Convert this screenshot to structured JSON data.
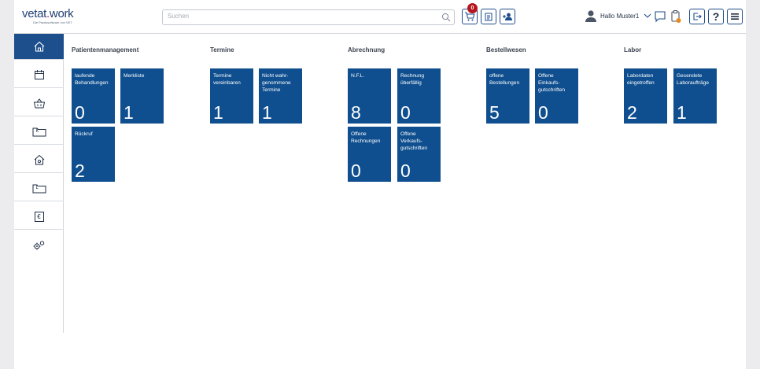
{
  "header": {
    "logo_main": "vetat",
    "logo_dot": ".",
    "logo_end": "work",
    "logo_sub": "Die Praxissoftware von VET",
    "search_placeholder": "Suchen",
    "cart_badge": "0",
    "user_label": "Hallo Muster1",
    "help_label": "?"
  },
  "sidebar": {
    "items": [
      {
        "icon": "home-icon",
        "active": true
      },
      {
        "icon": "calendar-icon"
      },
      {
        "icon": "basket-icon"
      },
      {
        "icon": "folder-k-icon",
        "letter": "K"
      },
      {
        "icon": "house-settings-icon"
      },
      {
        "icon": "folder-l-icon",
        "letter": "L"
      },
      {
        "icon": "euro-icon",
        "letter": "€"
      },
      {
        "icon": "gears-icon"
      }
    ]
  },
  "sections": {
    "patient": "Patientenmanagement",
    "termine": "Termine",
    "abrechnung": "Abrechnung",
    "bestellwesen": "Bestellwesen",
    "labor": "Labor"
  },
  "tiles": {
    "laufende": {
      "label": "laufende Behandlungen",
      "value": "0"
    },
    "merkliste": {
      "label": "Merkliste",
      "value": "1"
    },
    "rueckruf": {
      "label": "Rückruf",
      "value": "2"
    },
    "termine_vereinbaren": {
      "label": "Termine vereinbaren",
      "value": "1"
    },
    "nicht_wahrgenommen": {
      "label": "Nicht wahr-genommene Termine",
      "value": "1"
    },
    "nfl": {
      "label": "N.F.L.",
      "value": "8"
    },
    "rechnung_ueberfaellig": {
      "label": "Rechnung überfällig",
      "value": "0"
    },
    "offene_rechnungen": {
      "label": "Offene Rechnungen",
      "value": "0"
    },
    "offene_verkaufs": {
      "label": "Offene Verkaufs-gutschriften",
      "value": "0"
    },
    "offene_bestellungen": {
      "label": "offene Bestellungen",
      "value": "5"
    },
    "offene_einkaufs": {
      "label": "Offene Einkaufs-gutschriften",
      "value": "0"
    },
    "labordaten": {
      "label": "Labordaten eingetroffen",
      "value": "2"
    },
    "gesendete": {
      "label": "Gesendete Laboraufträge",
      "value": "1"
    }
  },
  "colors": {
    "tile": "#0f4f8f",
    "accent": "#1d4f8c",
    "badge": "#b5151c"
  }
}
